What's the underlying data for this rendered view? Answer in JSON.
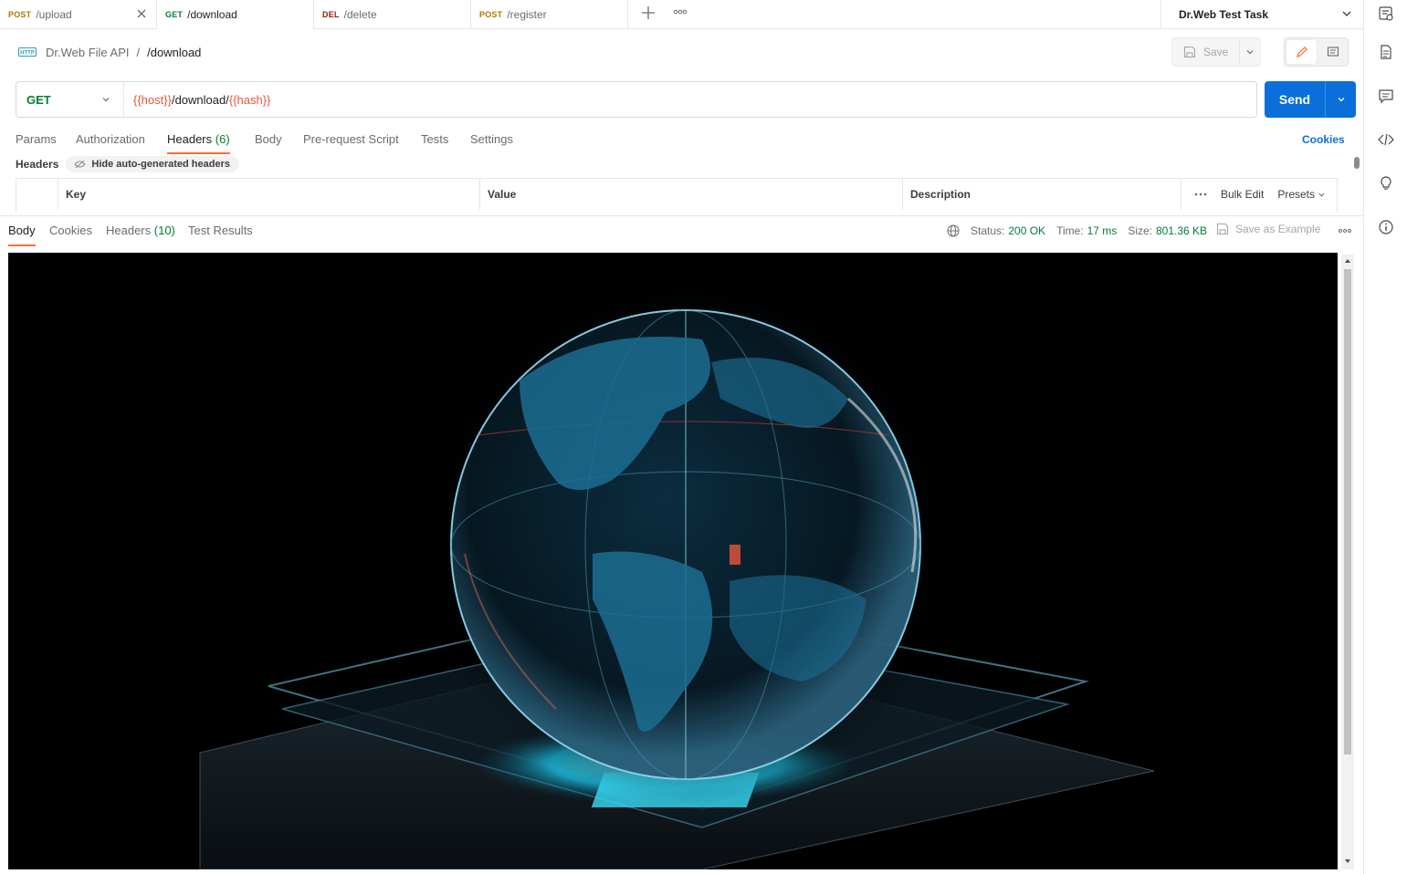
{
  "tabs": [
    {
      "method": "POST",
      "path": "/upload",
      "active": false
    },
    {
      "method": "GET",
      "path": "/download",
      "active": true
    },
    {
      "method": "DEL",
      "path": "/delete",
      "active": false
    },
    {
      "method": "POST",
      "path": "/register",
      "active": false
    }
  ],
  "environment": {
    "name": "Dr.Web Test Task"
  },
  "breadcrumb": {
    "collection": "Dr.Web File API",
    "separator": "/",
    "request": "/download"
  },
  "toolbar": {
    "save_label": "Save"
  },
  "request": {
    "method": "GET",
    "url_parts": [
      {
        "text": "{{host}}",
        "var": true
      },
      {
        "text": "/download/",
        "var": false
      },
      {
        "text": "{{hash}}",
        "var": true
      }
    ],
    "send_label": "Send"
  },
  "request_tabs": {
    "params": "Params",
    "authorization": "Authorization",
    "headers": "Headers",
    "headers_count": "(6)",
    "body": "Body",
    "prerequest": "Pre-request Script",
    "tests": "Tests",
    "settings": "Settings",
    "cookies_link": "Cookies"
  },
  "headers_section": {
    "title": "Headers",
    "hide_button": "Hide auto-generated headers"
  },
  "headers_table": {
    "columns": {
      "key": "Key",
      "value": "Value",
      "description": "Description"
    },
    "bulk_edit": "Bulk Edit",
    "presets": "Presets"
  },
  "response_tabs": {
    "body": "Body",
    "cookies": "Cookies",
    "headers": "Headers",
    "headers_count": "(10)",
    "test_results": "Test Results"
  },
  "response_status": {
    "status_label": "Status:",
    "status_value": "200 OK",
    "time_label": "Time:",
    "time_value": "17 ms",
    "size_label": "Size:",
    "size_value": "801.36 KB",
    "save_example": "Save as Example"
  },
  "colors": {
    "accent_orange": "#ff6c37",
    "send_blue": "#0a6fda",
    "get_green": "#007f31",
    "post_amber": "#ad7a03",
    "del_red": "#8e1a10",
    "variable_red": "#e8563c"
  },
  "response_body": {
    "type": "image",
    "subject": "glowing-globe-image"
  }
}
